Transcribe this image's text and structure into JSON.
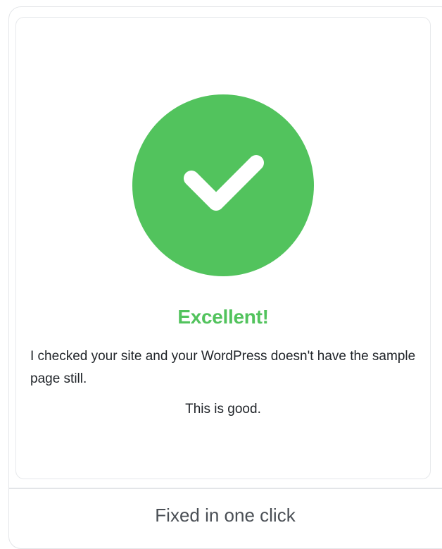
{
  "result_card": {
    "headline": "Excellent!",
    "message": "I checked your site and your WordPress doesn't have the sample page still.",
    "note": "This is good.",
    "icon": "check-circle-icon",
    "accent_color": "#52c35d"
  },
  "footer": {
    "label": "Fixed in one click"
  }
}
